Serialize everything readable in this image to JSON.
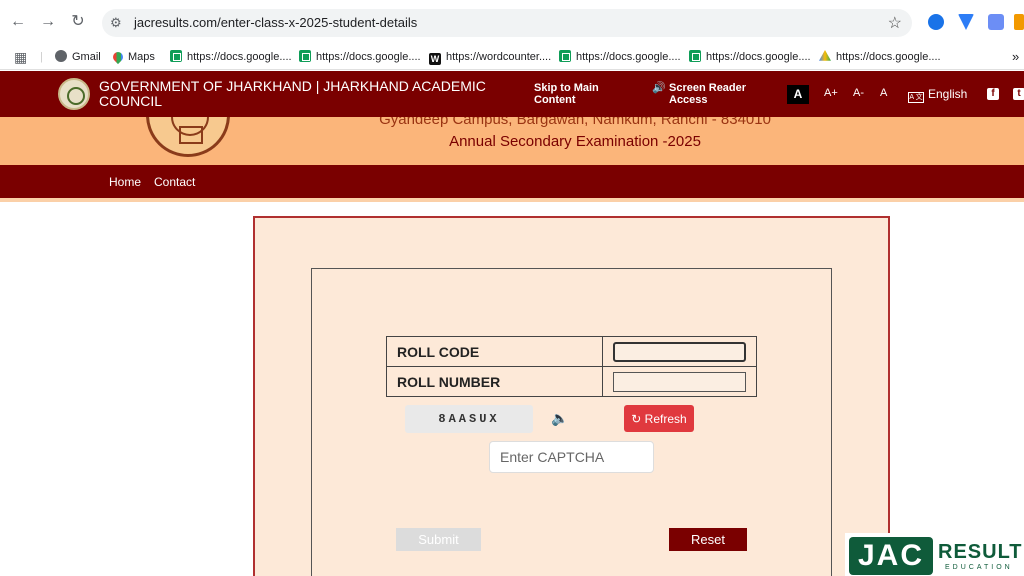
{
  "browser": {
    "url": "jacresults.com/enter-class-x-2025-student-details",
    "bookmarks": [
      {
        "label": "Gmail",
        "icon": "globe-icon"
      },
      {
        "label": "Maps",
        "icon": "maps-icon"
      },
      {
        "label": "https://docs.google....",
        "icon": "sheets-icon"
      },
      {
        "label": "https://docs.google....",
        "icon": "sheets-icon"
      },
      {
        "label": "https://wordcounter....",
        "icon": "wordcounter-icon"
      },
      {
        "label": "https://docs.google....",
        "icon": "sheets-icon"
      },
      {
        "label": "https://docs.google....",
        "icon": "sheets-icon"
      },
      {
        "label": "https://docs.google....",
        "icon": "drive-icon"
      }
    ],
    "bookmarks_more": "»"
  },
  "header": {
    "title": "GOVERNMENT OF JHARKHAND | JHARKHAND ACADEMIC COUNCIL",
    "skip_link": "Skip to Main Content",
    "screen_reader": "Screen Reader Access",
    "font_dark": "A",
    "font_plus": "A+",
    "font_minus": "A-",
    "font_normal": "A",
    "language": "English",
    "language_icon_text": "A 文"
  },
  "banner": {
    "address": "Gyandeep Campus, Bargawan, Namkum, Ranchi - 834010",
    "exam": "Annual Secondary Examination -2025"
  },
  "nav": {
    "home": "Home",
    "contact": "Contact"
  },
  "form": {
    "roll_code_label": "ROLL CODE",
    "roll_code_value": "",
    "roll_number_label": "ROLL NUMBER",
    "roll_number_value": "",
    "captcha_text": "8AASUX",
    "refresh_label": "Refresh",
    "captcha_placeholder": "Enter CAPTCHA",
    "submit_label": "Submit",
    "reset_label": "Reset"
  },
  "watermark": {
    "jac": "JAC",
    "result": "RESULT",
    "education": "EDUCATION"
  },
  "colors": {
    "maroon": "#7a0000",
    "banner": "#fbb57a",
    "form_bg": "#fde9d8",
    "refresh": "#e0393e",
    "watermark_green": "#0f5b3a"
  }
}
